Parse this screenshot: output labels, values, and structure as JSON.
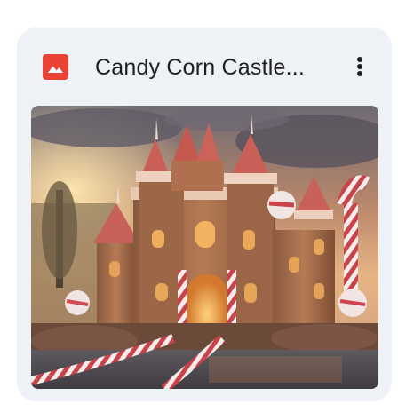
{
  "card": {
    "title": "Candy Corn Castle...",
    "file_type_icon": "image-file-icon",
    "more_icon": "more-vertical-icon",
    "thumbnail_icon": "castle-image-thumbnail"
  },
  "colors": {
    "card_background": "#eef1f6",
    "file_icon_red": "#ea4335",
    "title_text": "#1f1f1f"
  }
}
